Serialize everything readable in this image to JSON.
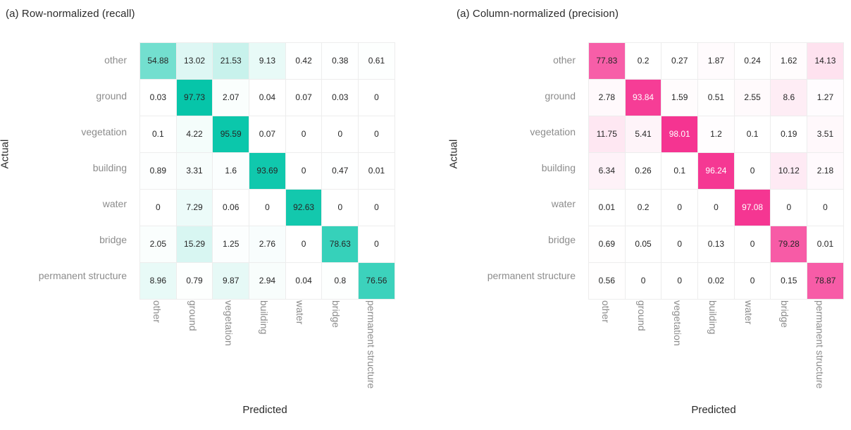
{
  "figure": {
    "classes": [
      "other",
      "ground",
      "vegetation",
      "building",
      "water",
      "bridge",
      "permanent structure"
    ],
    "x_axis_label": "Predicted",
    "y_axis_label": "Actual"
  },
  "panels": [
    {
      "id": "row-normalized",
      "title": "(a) Row-normalized (recall)",
      "accent_color": "#00c4a7"
    },
    {
      "id": "column-normalized",
      "title": "(a) Column-normalized (precision)",
      "accent_color": "#f5308f"
    }
  ],
  "chart_data": [
    {
      "type": "heatmap",
      "title": "(a) Row-normalized (recall)",
      "xlabel": "Predicted",
      "ylabel": "Actual",
      "colormap": "white-to-teal",
      "accent_color": "#00c4a7",
      "value_range": [
        0,
        100
      ],
      "units": "percent",
      "grid": true,
      "legend": "none",
      "x_categories": [
        "other",
        "ground",
        "vegetation",
        "building",
        "water",
        "bridge",
        "permanent structure"
      ],
      "y_categories": [
        "other",
        "ground",
        "vegetation",
        "building",
        "water",
        "bridge",
        "permanent structure"
      ],
      "rows": [
        {
          "label": "other",
          "values": [
            54.88,
            13.02,
            21.53,
            9.13,
            0.42,
            0.38,
            0.61
          ]
        },
        {
          "label": "ground",
          "values": [
            0.03,
            97.73,
            2.07,
            0.04,
            0.07,
            0.03,
            0
          ]
        },
        {
          "label": "vegetation",
          "values": [
            0.1,
            4.22,
            95.59,
            0.07,
            0,
            0,
            0
          ]
        },
        {
          "label": "building",
          "values": [
            0.89,
            3.31,
            1.6,
            93.69,
            0,
            0.47,
            0.01
          ]
        },
        {
          "label": "water",
          "values": [
            0,
            7.29,
            0.06,
            0,
            92.63,
            0,
            0
          ]
        },
        {
          "label": "bridge",
          "values": [
            2.05,
            15.29,
            1.25,
            2.76,
            0,
            78.63,
            0
          ]
        },
        {
          "label": "permanent structure",
          "values": [
            8.96,
            0.79,
            9.87,
            2.94,
            0.04,
            0.8,
            76.56
          ]
        }
      ]
    },
    {
      "type": "heatmap",
      "title": "(a) Column-normalized (precision)",
      "xlabel": "Predicted",
      "ylabel": "Actual",
      "colormap": "white-to-pink",
      "accent_color": "#f5308f",
      "value_range": [
        0,
        100
      ],
      "units": "percent",
      "grid": true,
      "legend": "none",
      "x_categories": [
        "other",
        "ground",
        "vegetation",
        "building",
        "water",
        "bridge",
        "permanent structure"
      ],
      "y_categories": [
        "other",
        "ground",
        "vegetation",
        "building",
        "water",
        "bridge",
        "permanent structure"
      ],
      "rows": [
        {
          "label": "other",
          "values": [
            77.83,
            0.2,
            0.27,
            1.87,
            0.24,
            1.62,
            14.13
          ]
        },
        {
          "label": "ground",
          "values": [
            2.78,
            93.84,
            1.59,
            0.51,
            2.55,
            8.6,
            1.27
          ]
        },
        {
          "label": "vegetation",
          "values": [
            11.75,
            5.41,
            98.01,
            1.2,
            0.1,
            0.19,
            3.51
          ]
        },
        {
          "label": "building",
          "values": [
            6.34,
            0.26,
            0.1,
            96.24,
            0,
            10.12,
            2.18
          ]
        },
        {
          "label": "water",
          "values": [
            0.01,
            0.2,
            0,
            0,
            97.08,
            0,
            0
          ]
        },
        {
          "label": "bridge",
          "values": [
            0.69,
            0.05,
            0,
            0.13,
            0,
            79.28,
            0.01
          ]
        },
        {
          "label": "permanent structure",
          "values": [
            0.56,
            0,
            0,
            0.02,
            0,
            0.15,
            78.87
          ]
        }
      ]
    }
  ]
}
